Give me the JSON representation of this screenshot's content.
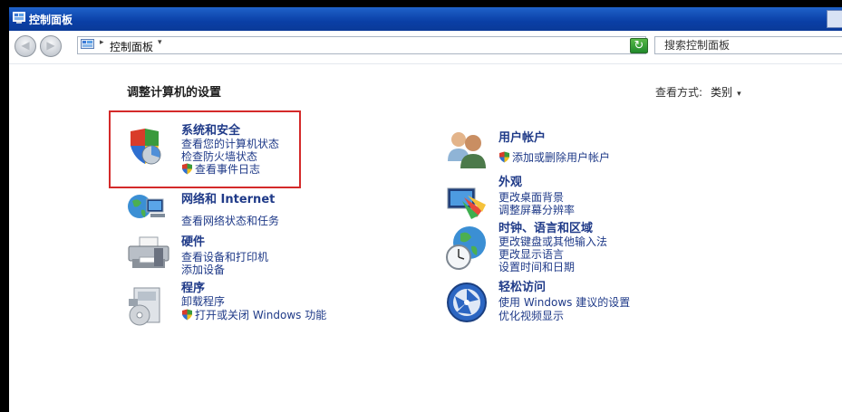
{
  "window": {
    "title": "控制面板"
  },
  "nav": {
    "back_glyph": "◀",
    "forward_glyph": "▶",
    "breadcrumb": "控制面板",
    "sep": "▸",
    "dropdown_glyph": "▾",
    "refresh_glyph": "↻",
    "search_placeholder": "搜索控制面板"
  },
  "content": {
    "heading": "调整计算机的设置",
    "view_by_label": "查看方式:",
    "view_by_value": "类别",
    "view_by_arrow": "▾"
  },
  "categories": {
    "security": {
      "title": "系统和安全",
      "links": [
        "查看您的计算机状态",
        "检查防火墙状态",
        "查看事件日志"
      ],
      "icon": "security-shield-icon"
    },
    "network": {
      "title": "网络和 Internet",
      "links": [
        "查看网络状态和任务"
      ],
      "icon": "network-globe-icon"
    },
    "hardware": {
      "title": "硬件",
      "links": [
        "查看设备和打印机",
        "添加设备"
      ],
      "icon": "printer-icon"
    },
    "programs": {
      "title": "程序",
      "links": [
        "卸载程序",
        "打开或关闭 Windows 功能"
      ],
      "icon": "programs-box-icon"
    },
    "users": {
      "title": "用户帐户",
      "links": [
        "添加或删除用户帐户"
      ],
      "icon": "users-icon"
    },
    "appearance": {
      "title": "外观",
      "links": [
        "更改桌面背景",
        "调整屏幕分辨率"
      ],
      "icon": "appearance-monitor-icon"
    },
    "clock": {
      "title": "时钟、语言和区域",
      "links": [
        "更改键盘或其他输入法",
        "更改显示语言",
        "设置时间和日期"
      ],
      "icon": "clock-globe-icon"
    },
    "access": {
      "title": "轻松访问",
      "links": [
        "使用 Windows 建议的设置",
        "优化视频显示"
      ],
      "icon": "ease-of-access-icon"
    }
  },
  "colors": {
    "link": "#1f3a88",
    "highlight_border": "#d42a2a",
    "titlebar": "#0a3fa6"
  }
}
